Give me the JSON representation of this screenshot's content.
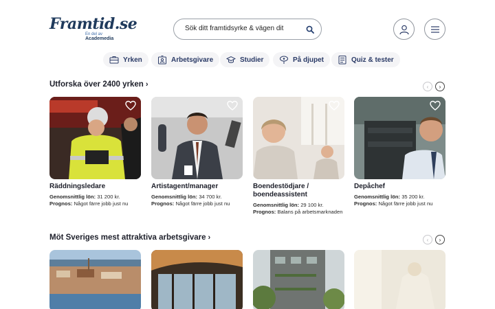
{
  "logo": {
    "name": "Framtid.se",
    "sub1": "En del av",
    "sub2": "Academedia"
  },
  "search": {
    "placeholder": "Sök ditt framtidsyrke & vägen dit"
  },
  "nav": [
    {
      "label": "Yrken",
      "icon": "briefcase-icon"
    },
    {
      "label": "Arbetsgivare",
      "icon": "employer-badge-icon"
    },
    {
      "label": "Studier",
      "icon": "graduation-cap-icon"
    },
    {
      "label": "På djupet",
      "icon": "insight-icon"
    },
    {
      "label": "Quiz & tester",
      "icon": "checklist-icon"
    }
  ],
  "section1": {
    "title": "Utforska över 2400 yrken",
    "cards": [
      {
        "title": "Räddningsledare",
        "salary_label": "Genomsnittlig lön:",
        "salary": "31 200 kr.",
        "prognos_label": "Prognos:",
        "prognos": "Något färre jobb just nu"
      },
      {
        "title": "Artistagent/manager",
        "salary_label": "Genomsnittlig lön:",
        "salary": "34 700 kr.",
        "prognos_label": "Prognos:",
        "prognos": "Något färre jobb just nu"
      },
      {
        "title": "Boendestödjare / boendeassistent",
        "salary_label": "Genomsnittlig lön:",
        "salary": "29 100 kr.",
        "prognos_label": "Prognos:",
        "prognos": "Balans på arbetsmarknaden"
      },
      {
        "title": "Depåchef",
        "salary_label": "Genomsnittlig lön:",
        "salary": "35 200 kr.",
        "prognos_label": "Prognos:",
        "prognos": "Något färre jobb just nu"
      }
    ]
  },
  "section2": {
    "title": "Möt Sveriges mest attraktiva arbetsgivare"
  },
  "colors": {
    "brand": "#1f3a5c",
    "nav_text": "#2a3a66",
    "nav_bg": "#f4f4f6"
  }
}
